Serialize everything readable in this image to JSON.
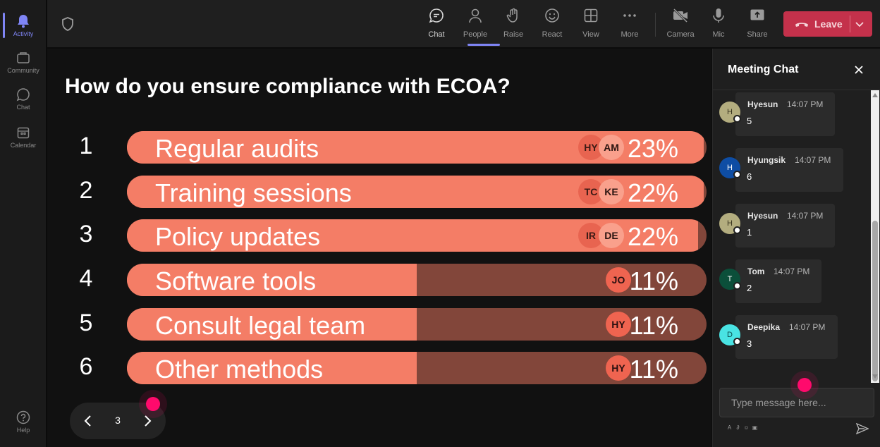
{
  "rail": [
    {
      "label": "Activity",
      "icon": "bell-icon",
      "active": true
    },
    {
      "label": "Community",
      "icon": "community-icon"
    },
    {
      "label": "Chat",
      "icon": "chat-icon"
    },
    {
      "label": "Calendar",
      "icon": "calendar-icon"
    },
    {
      "label": "Help",
      "icon": "help-icon"
    }
  ],
  "toolbar": {
    "chat": "Chat",
    "people": "People",
    "raise": "Raise",
    "react": "React",
    "view": "View",
    "more": "More",
    "camera": "Camera",
    "mic": "Mic",
    "share": "Share",
    "leave": "Leave"
  },
  "poll": {
    "question": "How do you ensure compliance with ECOA?",
    "options": [
      {
        "num": "1",
        "label": "Regular audits",
        "pct": "23%",
        "fraction": 0.995,
        "avatars": [
          "HY",
          "AM"
        ]
      },
      {
        "num": "2",
        "label": "Training sessions",
        "pct": "22%",
        "fraction": 0.995,
        "avatars": [
          "TC",
          "KE"
        ]
      },
      {
        "num": "3",
        "label": "Policy updates",
        "pct": "22%",
        "fraction": 0.985,
        "avatars": [
          "IR",
          "DE"
        ]
      },
      {
        "num": "4",
        "label": "Software tools",
        "pct": "11%",
        "fraction": 0.5,
        "avatars": [
          "JO"
        ]
      },
      {
        "num": "5",
        "label": "Consult legal team",
        "pct": "11%",
        "fraction": 0.5,
        "avatars": [
          "HY"
        ]
      },
      {
        "num": "6",
        "label": "Other methods",
        "pct": "11%",
        "fraction": 0.5,
        "avatars": [
          "HY"
        ]
      }
    ]
  },
  "pager": {
    "page": "3"
  },
  "chat": {
    "title": "Meeting Chat",
    "input_placeholder": "Type message here...",
    "messages": [
      {
        "initial": "H",
        "name": "Hyesun",
        "time": "14:07 PM",
        "text": "5",
        "color": "#b3ad7f",
        "textColor": "#3a3520"
      },
      {
        "initial": "H",
        "name": "Hyungsik",
        "time": "14:07 PM",
        "text": "6",
        "color": "#0e4da4",
        "textColor": "#ffffff"
      },
      {
        "initial": "H",
        "name": "Hyesun",
        "time": "14:07 PM",
        "text": "1",
        "color": "#b3ad7f",
        "textColor": "#3a3520"
      },
      {
        "initial": "T",
        "name": "Tom",
        "time": "14:07 PM",
        "text": "2",
        "color": "#0b4f3a",
        "textColor": "#ffffff"
      },
      {
        "initial": "D",
        "name": "Deepika",
        "time": "14:07 PM",
        "text": "3",
        "color": "#49e3e3",
        "textColor": "#0a4a4a"
      }
    ]
  },
  "colors": {
    "bar_fill": "#f47d66",
    "bar_track": "#82463a",
    "accent": "#7f85f5",
    "leave": "#c4314b"
  }
}
